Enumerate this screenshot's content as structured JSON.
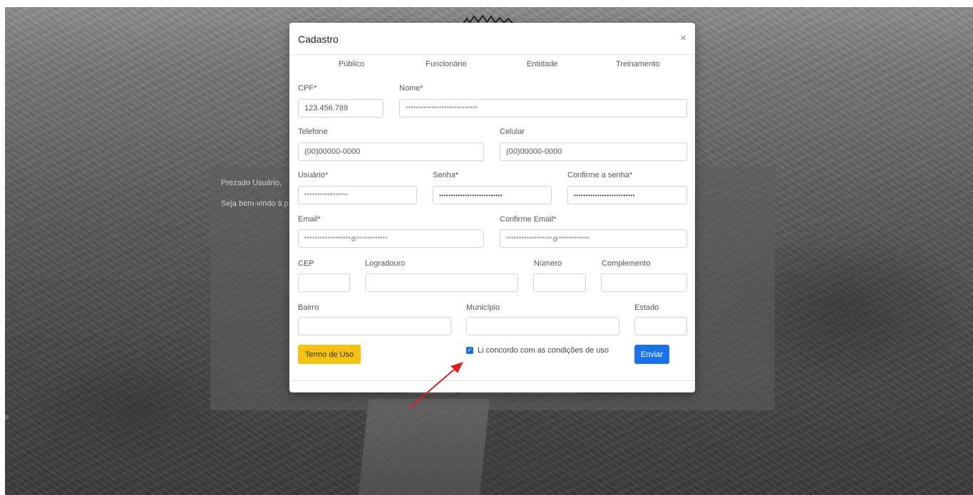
{
  "background": {
    "greeting": "Prezado Usuário,",
    "welcome": "Seja bem-vindo à p"
  },
  "modal": {
    "title": "Cadastro",
    "close_icon": "×",
    "tabs": [
      "Público",
      "Funcionário",
      "Entidade",
      "Treinamento"
    ],
    "fields": {
      "cpf": {
        "label": "CPF*",
        "value": "123.456.789"
      },
      "nome": {
        "label": "Nome*",
        "value": "****************************"
      },
      "telefone": {
        "label": "Telefone",
        "value": "(00)00000-0000"
      },
      "celular": {
        "label": "Celular",
        "value": "(00)00000-0000"
      },
      "usuario": {
        "label": "Usuário*",
        "value": "*****************"
      },
      "senha": {
        "label": "Senha*",
        "value": "•••••••••••••••••••••••••••"
      },
      "confirme_senha": {
        "label": "Confirme a senha*",
        "value": "••••••••••••••••••••••••••"
      },
      "email": {
        "label": "Email*",
        "value": "******************@************"
      },
      "confirme_email": {
        "label": "Confirme Email*",
        "value": "******************@************"
      },
      "cep": {
        "label": "CEP",
        "value": ""
      },
      "logradouro": {
        "label": "Logradouro",
        "value": ""
      },
      "numero": {
        "label": "Número",
        "value": ""
      },
      "complemento": {
        "label": "Complemento",
        "value": ""
      },
      "bairro": {
        "label": "Bairro",
        "value": ""
      },
      "municipio": {
        "label": "Município",
        "value": ""
      },
      "estado": {
        "label": "Estado",
        "value": ""
      }
    },
    "terms_button": "Termo de Uso",
    "agree_checkbox": {
      "label": "Li concordo com as condições de uso",
      "checked": true
    },
    "submit_button": "Enviar"
  },
  "colors": {
    "terms_button": "#f5c211",
    "submit_button": "#1a73e8",
    "checkbox": "#1f6fd6",
    "annotation_arrow": "#e02020"
  }
}
